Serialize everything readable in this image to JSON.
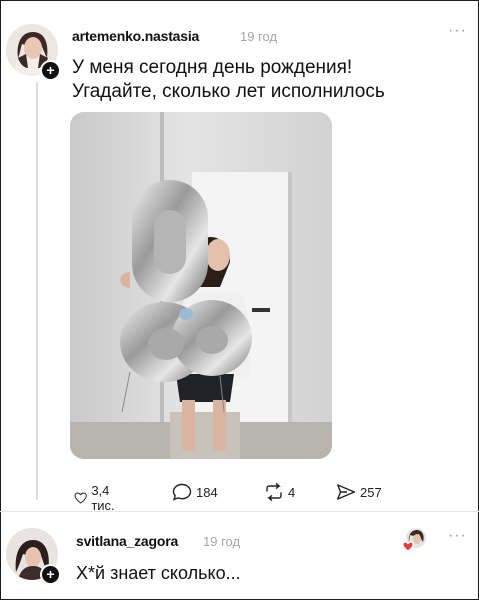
{
  "post": {
    "username": "artemenko.nastasia",
    "time": "19 год",
    "more_icon": "more-horizontal-icon",
    "text_line1": "У меня сегодня день рождения!",
    "text_line2": "Угадайте, сколько лет исполнилось",
    "photo_balloon_number": "08",
    "actions": {
      "likes": "3,4 тис.",
      "comments": "184",
      "reposts": "4",
      "shares": "257"
    }
  },
  "reply": {
    "username": "svitlana_zagora",
    "time": "19 год",
    "text": "Х*й знает сколько...",
    "more_icon": "more-horizontal-icon"
  },
  "colors": {
    "text": "#111111",
    "muted": "#a6a6a6",
    "divider": "#e6e6e6",
    "like_heart": "#e0403b"
  }
}
